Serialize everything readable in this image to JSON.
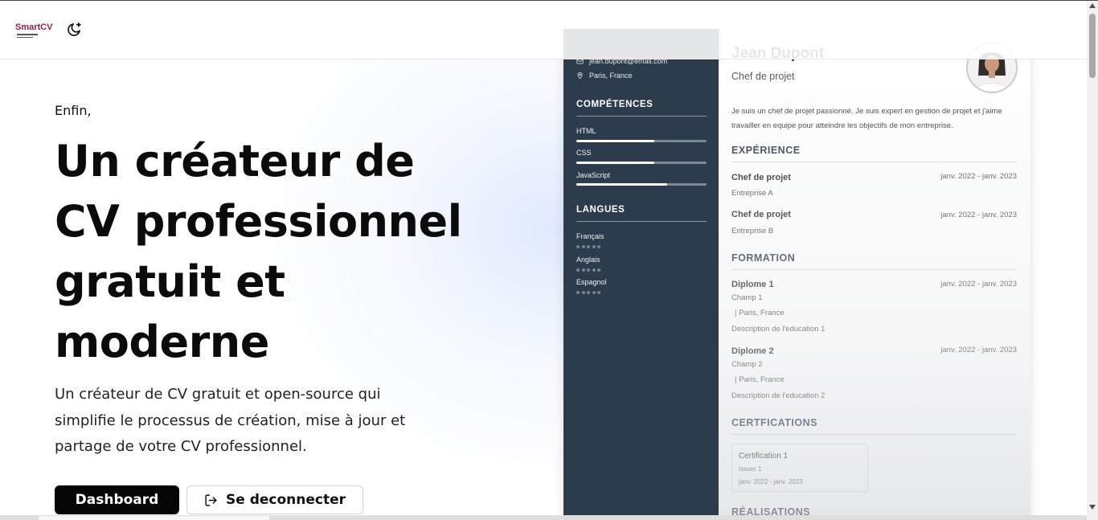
{
  "header": {
    "logo_text": "SmartCV",
    "theme_icon": "moon-plus-icon"
  },
  "hero": {
    "eyebrow": "Enfin,",
    "headline": "Un créateur de CV professionnel gratuit et moderne",
    "subtitle": "Un créateur de CV gratuit et open-source qui simplifie le processus de création, mise à jour et partage de votre CV professionnel.",
    "primary_button": "Dashboard",
    "secondary_button": "Se deconnecter",
    "secondary_icon": "logout-icon"
  },
  "cv": {
    "name": "Jean Dupont",
    "role": "Chef de projet",
    "summary": "Je suis un chef de projet passionné. Je suis expert en gestion de projet et j'aime travailler en equipe pour atteindre les objectifs de mon entreprise.",
    "contact": {
      "email": "jean.dupont@email.com",
      "location": "Paris, France"
    },
    "skills_title": "COMPÉTENCES",
    "skills": [
      {
        "name": "HTML",
        "level": 0.6
      },
      {
        "name": "CSS",
        "level": 0.6
      },
      {
        "name": "JavaScript",
        "level": 0.7
      }
    ],
    "languages_title": "LANGUES",
    "languages": [
      {
        "name": "Français"
      },
      {
        "name": "Anglais"
      },
      {
        "name": "Espagnol"
      }
    ],
    "experience_title": "EXPÉRIENCE",
    "experience": [
      {
        "title": "Chef de projet",
        "company": "Entreprise A",
        "dates": "janv. 2022 - janv. 2023"
      },
      {
        "title": "Chef de projet",
        "company": "Entreprise B",
        "dates": "janv. 2022 - janv. 2023"
      }
    ],
    "education_title": "FORMATION",
    "education": [
      {
        "title": "Diplome 1",
        "field": "Champ 1",
        "location": "|  Paris, France",
        "description": "Description de l'education 1",
        "dates": "janv. 2022 - janv. 2023"
      },
      {
        "title": "Diplome 2",
        "field": "Champ 2",
        "location": "|  Paris, France",
        "description": "Description de l'education 2",
        "dates": "janv. 2022 - janv. 2023"
      }
    ],
    "certifications_title": "CERTFICATIONS",
    "certifications": [
      {
        "title": "Certification 1",
        "issuer": "Issuer 1",
        "dates": "janv. 2022 - janv. 2023"
      }
    ],
    "achievements_title": "RÉALISATIONS"
  }
}
